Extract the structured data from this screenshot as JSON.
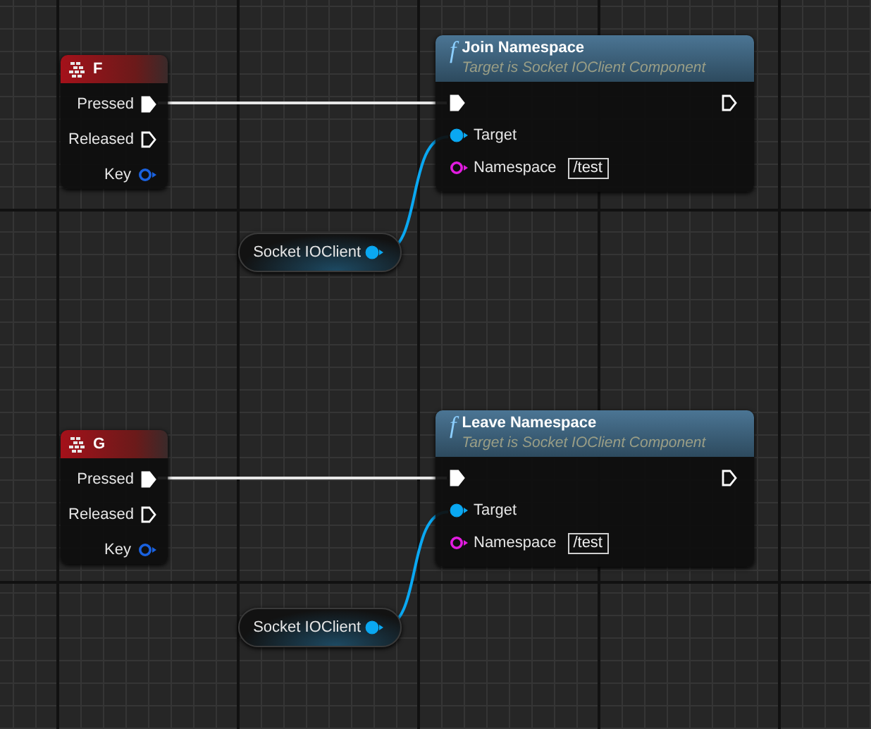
{
  "groups": [
    {
      "event": {
        "title": "F",
        "pins": [
          {
            "label": "Pressed",
            "kind": "exec",
            "connected": true
          },
          {
            "label": "Released",
            "kind": "exec",
            "connected": false
          },
          {
            "label": "Key",
            "kind": "key",
            "connected": false
          }
        ]
      },
      "function": {
        "glyph": "f",
        "title": "Join Namespace",
        "subtitle": "Target is Socket IOClient Component",
        "pins": [
          {
            "kind": "exec_in",
            "connected": true
          },
          {
            "kind": "exec_out",
            "connected": false
          },
          {
            "label": "Target",
            "kind": "object",
            "connected": true
          },
          {
            "label": "Namespace",
            "kind": "string",
            "connected": false,
            "value": "/test"
          }
        ]
      },
      "variable": {
        "label": "Socket IOClient",
        "connected": true
      }
    },
    {
      "event": {
        "title": "G",
        "pins": [
          {
            "label": "Pressed",
            "kind": "exec",
            "connected": true
          },
          {
            "label": "Released",
            "kind": "exec",
            "connected": false
          },
          {
            "label": "Key",
            "kind": "key",
            "connected": false
          }
        ]
      },
      "function": {
        "glyph": "f",
        "title": "Leave Namespace",
        "subtitle": "Target is Socket IOClient Component",
        "pins": [
          {
            "kind": "exec_in",
            "connected": true
          },
          {
            "kind": "exec_out",
            "connected": false
          },
          {
            "label": "Target",
            "kind": "object",
            "connected": true
          },
          {
            "label": "Namespace",
            "kind": "string",
            "connected": false,
            "value": "/test"
          }
        ]
      },
      "variable": {
        "label": "Socket IOClient",
        "connected": true
      }
    }
  ]
}
